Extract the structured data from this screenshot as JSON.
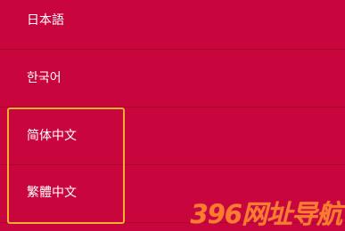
{
  "languages": [
    {
      "label": "日本語"
    },
    {
      "label": "한국어"
    },
    {
      "label": "简体中文"
    },
    {
      "label": "繁體中文"
    }
  ],
  "watermark": {
    "text": "396网址导航"
  },
  "colors": {
    "background": "#c8063d",
    "focus_outline": "#f3b22c",
    "text": "#ffffff",
    "watermark": "#ff8a2b"
  }
}
